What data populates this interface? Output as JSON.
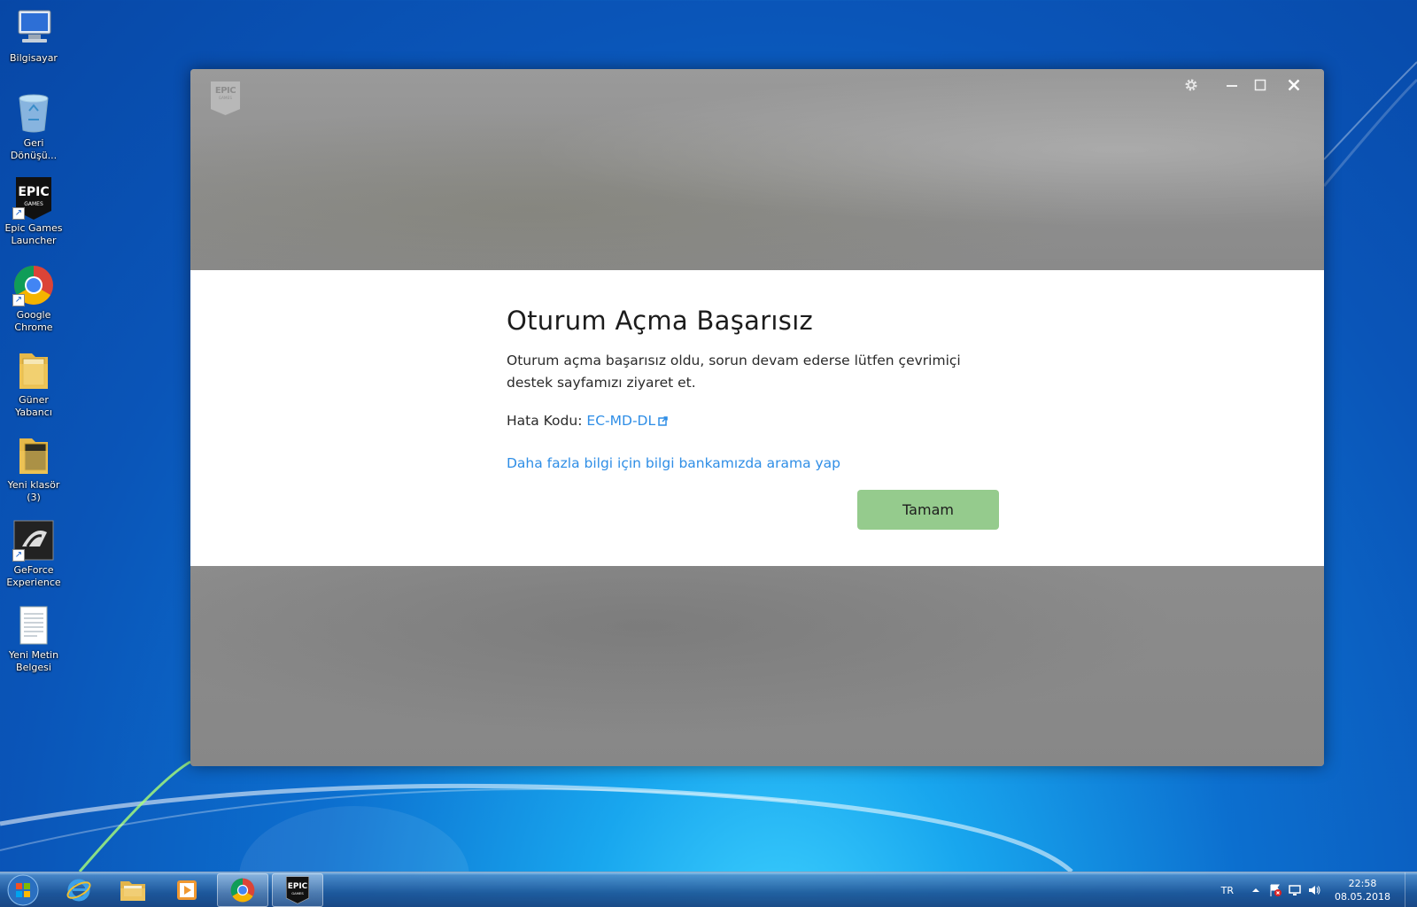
{
  "desktop": {
    "icons": [
      {
        "label": "Bilgisayar",
        "icon": "computer-icon"
      },
      {
        "label": "Geri Dönüşü...",
        "icon": "recycle-bin-icon"
      },
      {
        "label": "Epic Games Launcher",
        "icon": "epic-games-icon"
      },
      {
        "label": "Google Chrome",
        "icon": "chrome-icon"
      },
      {
        "label": "Güner Yabancı",
        "icon": "folder-icon"
      },
      {
        "label": "Yeni klasör (3)",
        "icon": "folder-icon"
      },
      {
        "label": "GeForce Experience",
        "icon": "geforce-icon"
      },
      {
        "label": "Yeni Metin Belgesi",
        "icon": "text-document-icon"
      }
    ]
  },
  "launcher": {
    "logo_line1": "EPIC",
    "logo_line2": "GAMES",
    "dialog": {
      "title": "Oturum Açma Başarısız",
      "message": "Oturum açma başarısız oldu, sorun devam ederse lütfen çevrimiçi destek sayfamızı ziyaret et.",
      "error_label": "Hata Kodu:",
      "error_code": "EC-MD-DL",
      "kb_link": "Daha fazla bilgi için bilgi bankamızda arama yap",
      "ok_button": "Tamam"
    },
    "accent_link_color": "#2f8ee6",
    "ok_button_color": "#95cb8d"
  },
  "taskbar": {
    "pinned": [
      "internet-explorer-icon",
      "file-explorer-icon",
      "media-player-icon",
      "chrome-icon",
      "epic-games-icon"
    ],
    "tray": {
      "language": "TR",
      "time": "22:58",
      "date": "08.05.2018"
    }
  }
}
